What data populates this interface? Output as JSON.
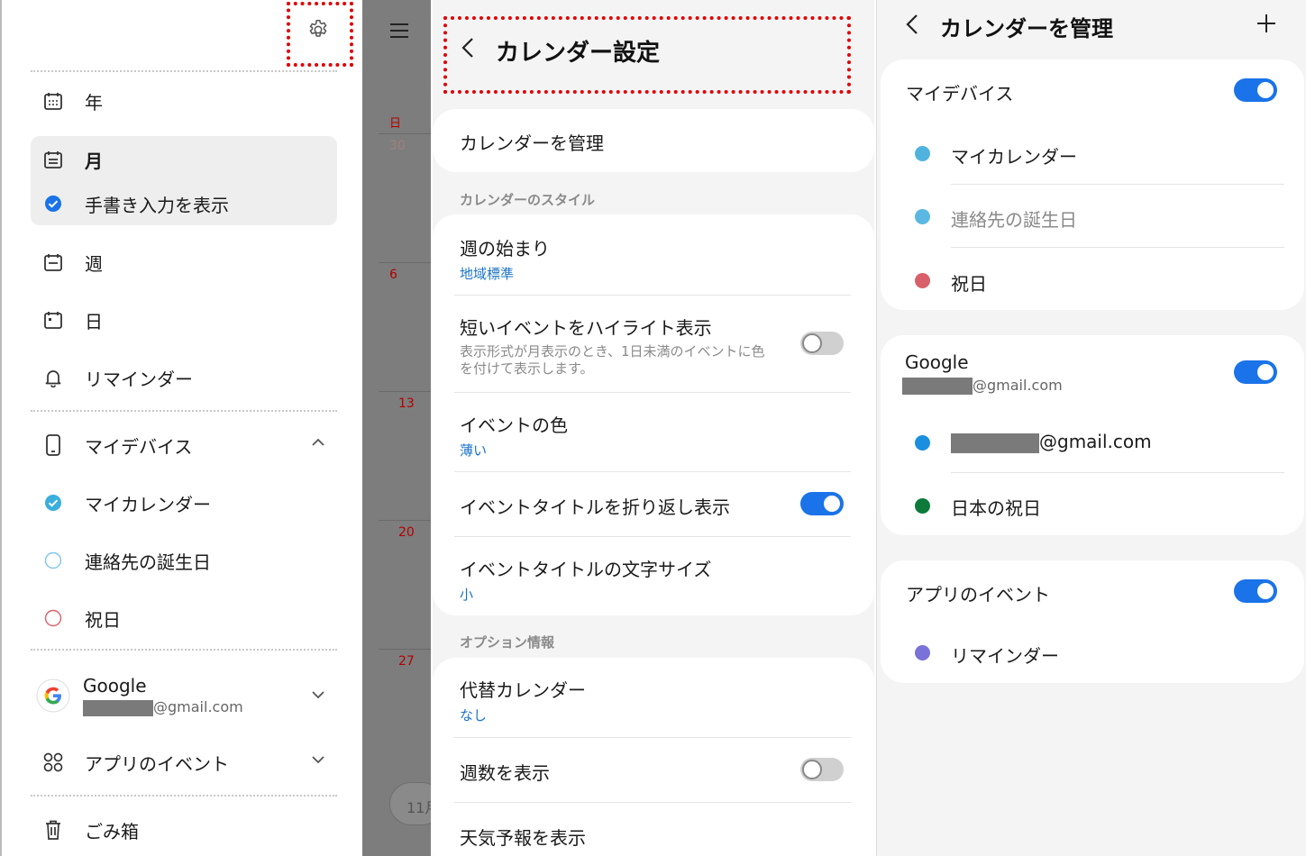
{
  "drawer": {
    "views": [
      {
        "label": "年",
        "icon": "calendar-year-icon"
      },
      {
        "label": "月",
        "icon": "calendar-month-icon"
      },
      {
        "label": "手書き入力を表示",
        "icon": "check-circle-icon"
      },
      {
        "label": "週",
        "icon": "calendar-week-icon"
      },
      {
        "label": "日",
        "icon": "calendar-day-icon"
      },
      {
        "label": "リマインダー",
        "icon": "bell-icon"
      }
    ],
    "my_device": {
      "label": "マイデバイス",
      "icon": "phone-icon"
    },
    "calendars": [
      {
        "label": "マイカレンダー",
        "color": "#3aaedc",
        "checked": true
      },
      {
        "label": "連絡先の誕生日",
        "color": "#7fc6e6",
        "checked": false
      },
      {
        "label": "祝日",
        "color": "#d9606a",
        "checked": false
      }
    ],
    "google": {
      "label": "Google",
      "email_suffix": "@gmail.com"
    },
    "app_events": {
      "label": "アプリのイベント"
    },
    "trash": {
      "label": "ごみ箱"
    }
  },
  "strip": {
    "day_header": "日",
    "dates": [
      "30",
      "6",
      "13",
      "20",
      "27"
    ],
    "pill_text": "11月"
  },
  "settings": {
    "title": "カレンダー設定",
    "manage_label": "カレンダーを管理",
    "style_section": "カレンダーのスタイル",
    "week_start": {
      "label": "週の始まり",
      "value": "地域標準"
    },
    "highlight_short": {
      "label": "短いイベントをハイライト表示",
      "desc": "表示形式が月表示のとき、1日未満のイベントに色を付けて表示します。",
      "enabled": false
    },
    "event_color": {
      "label": "イベントの色",
      "value": "薄い"
    },
    "wrap_title": {
      "label": "イベントタイトルを折り返し表示",
      "enabled": true
    },
    "title_font_size": {
      "label": "イベントタイトルの文字サイズ",
      "value": "小"
    },
    "options_section": "オプション情報",
    "alt_calendar": {
      "label": "代替カレンダー",
      "value": "なし"
    },
    "show_week_numbers": {
      "label": "週数を表示",
      "enabled": false
    },
    "weather": {
      "label": "天気予報を表示"
    }
  },
  "manage": {
    "title": "カレンダーを管理",
    "my_device": {
      "label": "マイデバイス",
      "enabled": true,
      "items": [
        {
          "label": "マイカレンダー",
          "color": "#4fb3de"
        },
        {
          "label": "連絡先の誕生日",
          "color": "#5ab8e2"
        },
        {
          "label": "祝日",
          "color": "#d9606a"
        }
      ]
    },
    "google": {
      "label": "Google",
      "email_suffix": "@gmail.com",
      "enabled": true,
      "items": [
        {
          "label_suffix": "@gmail.com",
          "color": "#1a8fe0"
        },
        {
          "label": "日本の祝日",
          "color": "#0e7a3a"
        }
      ]
    },
    "app_events": {
      "label": "アプリのイベント",
      "enabled": true,
      "items": [
        {
          "label": "リマインダー",
          "color": "#7a72d8"
        }
      ]
    }
  }
}
